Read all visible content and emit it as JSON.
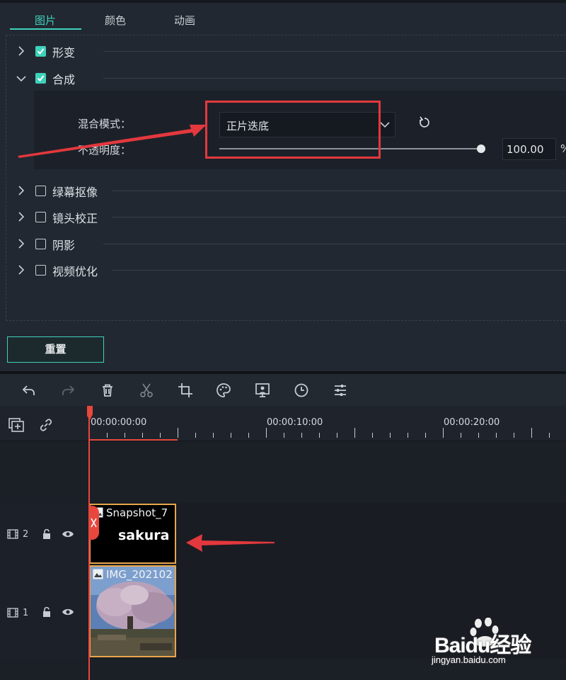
{
  "tabs": [
    {
      "label": "图片",
      "active": true
    },
    {
      "label": "颜色",
      "active": false
    },
    {
      "label": "动画",
      "active": false
    }
  ],
  "sections": [
    {
      "label": "形变",
      "checked": true,
      "expanded": false
    },
    {
      "label": "合成",
      "checked": true,
      "expanded": true
    },
    {
      "label": "绿幕抠像",
      "checked": false,
      "expanded": false
    },
    {
      "label": "镜头校正",
      "checked": false,
      "expanded": false
    },
    {
      "label": "阴影",
      "checked": false,
      "expanded": false
    },
    {
      "label": "视频优化",
      "checked": false,
      "expanded": false
    }
  ],
  "composite": {
    "blend_mode_label": "混合模式：",
    "blend_mode_value": "正片迭底",
    "opacity_label": "不透明度：",
    "opacity_value": "100.00",
    "opacity_unit": "%",
    "opacity_fraction": 1.0
  },
  "reset_button": "重置",
  "toolbar": [
    "undo-icon",
    "redo-icon",
    "delete-icon",
    "cut-icon",
    "crop-icon",
    "color-palette-icon",
    "green-screen-icon",
    "speed-clock-icon",
    "adjust-sliders-icon"
  ],
  "timeline": {
    "timecodes": [
      "00:00:00:00",
      "00:00:10:00",
      "00:00:20:00"
    ],
    "tracks": [
      {
        "number": "2",
        "clip_title": "Snapshot_7",
        "clip_text": "sakura"
      },
      {
        "number": "1",
        "clip_title": "IMG_202102"
      }
    ]
  },
  "watermark": {
    "brand": "Baidu经验",
    "url": "jingyan.baidu.com"
  },
  "colors": {
    "accent": "#3fd1bb",
    "highlight": "#e3383e",
    "playhead": "#e8473d",
    "clip_border": "#e8a54b"
  }
}
